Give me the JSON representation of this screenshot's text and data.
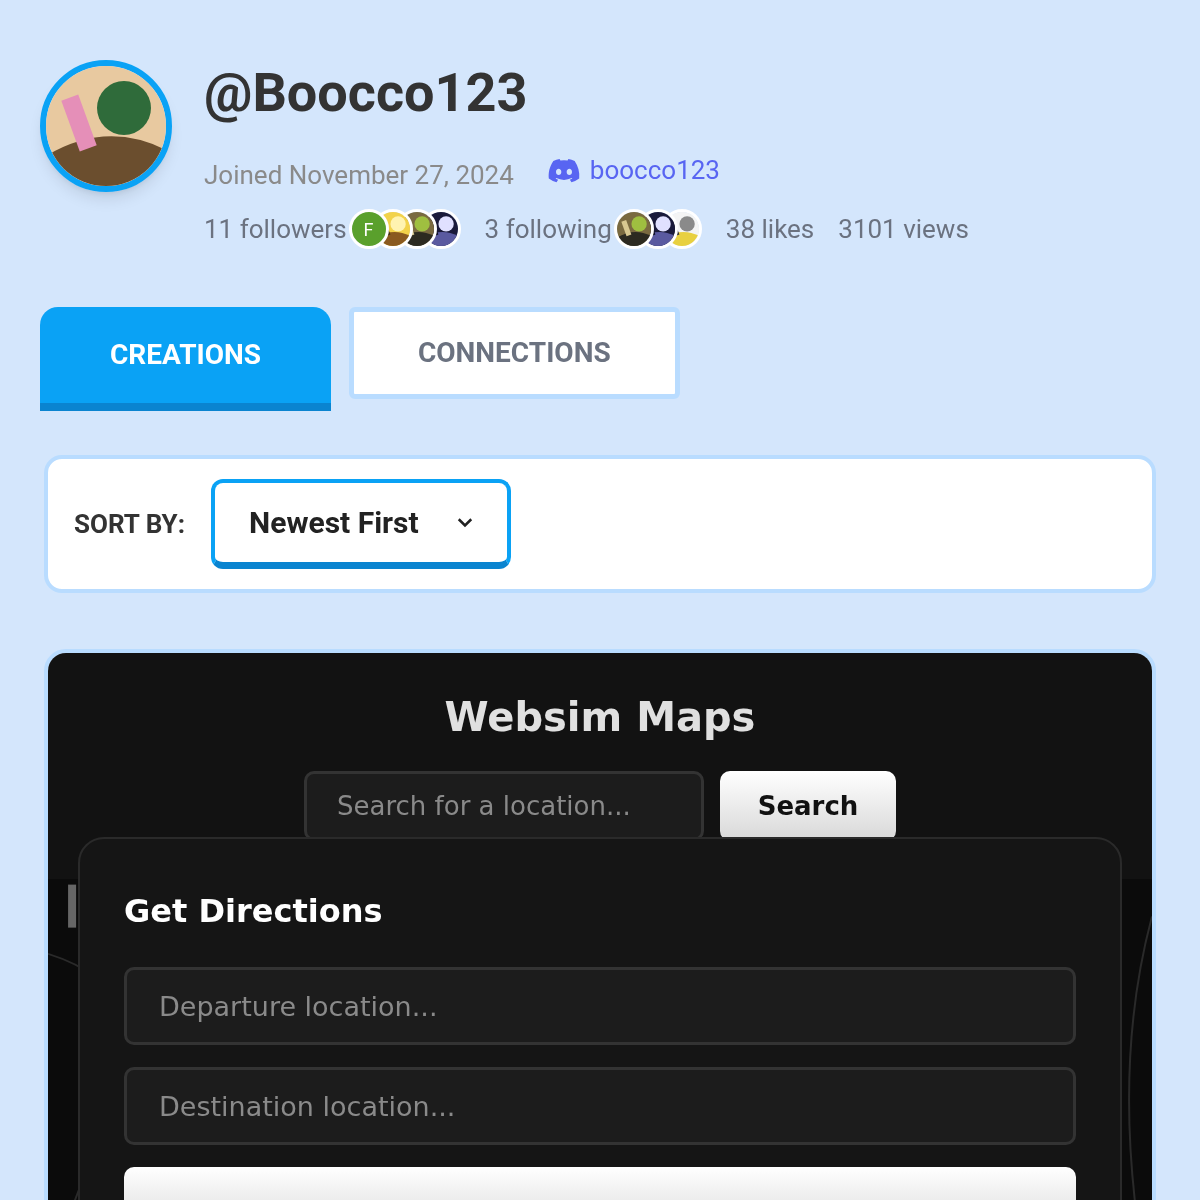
{
  "profile": {
    "username": "@Boocco123",
    "joined": "Joined November 27, 2024",
    "discord": "boocco123",
    "followers": "11 followers",
    "follower_avatars": [
      {
        "kind": "letter",
        "letter": "F",
        "color": "#5aa02c"
      },
      {
        "kind": "picture"
      },
      {
        "kind": "picture"
      },
      {
        "kind": "picture"
      }
    ],
    "following": "3 following",
    "following_avatars": [
      {
        "kind": "picture"
      },
      {
        "kind": "picture"
      },
      {
        "kind": "picture"
      }
    ],
    "likes": "38 likes",
    "views": "3101 views"
  },
  "tabs": [
    {
      "label": "CREATIONS",
      "selected": true
    },
    {
      "label": "CONNECTIONS",
      "selected": false
    }
  ],
  "sort": {
    "label": "SORT BY:",
    "value": "Newest First"
  },
  "app": {
    "title": "Websim Maps",
    "search_placeholder": "Search for a location...",
    "search_button": "Search",
    "panel_title": "Get Directions",
    "departure_placeholder": "Departure location...",
    "destination_placeholder": "Destination location..."
  }
}
